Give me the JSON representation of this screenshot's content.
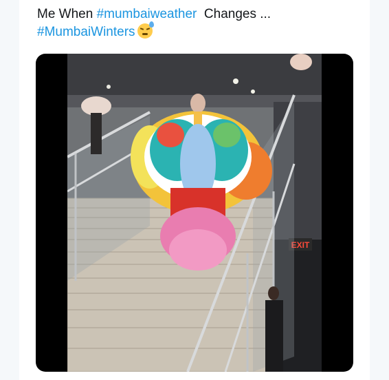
{
  "tweet": {
    "text_prefix": "Me When ",
    "hashtag1": "#mumbaiweather",
    "text_middle": "  Changes ...",
    "hashtag2": "#MumbaiWinters",
    "emoji": "dizzy-sweat-face-icon"
  },
  "media": {
    "type": "video",
    "sign_text": "EXIT"
  },
  "colors": {
    "hashtag": "#1b95e0",
    "text": "#14171a",
    "background": "#f5f8fa"
  }
}
